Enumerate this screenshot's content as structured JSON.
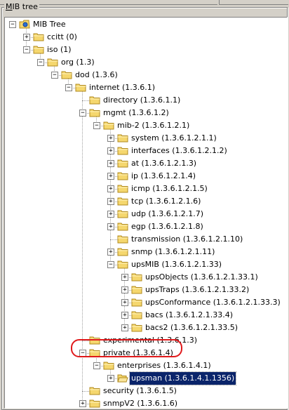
{
  "panel": {
    "title": "MIB tree"
  },
  "tree": [
    {
      "label": "MIB Tree",
      "level": 0,
      "exp": "-",
      "icon": "root"
    },
    {
      "label": "ccitt (0)",
      "level": 1,
      "exp": "+",
      "icon": "folder"
    },
    {
      "label": "iso (1)",
      "level": 1,
      "exp": "-",
      "icon": "folder"
    },
    {
      "label": "org (1.3)",
      "level": 2,
      "exp": "-",
      "icon": "folder"
    },
    {
      "label": "dod (1.3.6)",
      "level": 3,
      "exp": "-",
      "icon": "folder"
    },
    {
      "label": "internet (1.3.6.1)",
      "level": 4,
      "exp": "-",
      "icon": "folder"
    },
    {
      "label": "directory (1.3.6.1.1)",
      "level": 5,
      "exp": "",
      "icon": "folder"
    },
    {
      "label": "mgmt (1.3.6.1.2)",
      "level": 5,
      "exp": "-",
      "icon": "folder"
    },
    {
      "label": "mib-2 (1.3.6.1.2.1)",
      "level": 6,
      "exp": "-",
      "icon": "folder"
    },
    {
      "label": "system (1.3.6.1.2.1.1)",
      "level": 7,
      "exp": "+",
      "icon": "folder"
    },
    {
      "label": "interfaces (1.3.6.1.2.1.2)",
      "level": 7,
      "exp": "+",
      "icon": "folder"
    },
    {
      "label": "at (1.3.6.1.2.1.3)",
      "level": 7,
      "exp": "+",
      "icon": "folder"
    },
    {
      "label": "ip (1.3.6.1.2.1.4)",
      "level": 7,
      "exp": "+",
      "icon": "folder"
    },
    {
      "label": "icmp (1.3.6.1.2.1.5)",
      "level": 7,
      "exp": "+",
      "icon": "folder"
    },
    {
      "label": "tcp (1.3.6.1.2.1.6)",
      "level": 7,
      "exp": "+",
      "icon": "folder"
    },
    {
      "label": "udp (1.3.6.1.2.1.7)",
      "level": 7,
      "exp": "+",
      "icon": "folder"
    },
    {
      "label": "egp (1.3.6.1.2.1.8)",
      "level": 7,
      "exp": "+",
      "icon": "folder"
    },
    {
      "label": "transmission (1.3.6.1.2.1.10)",
      "level": 7,
      "exp": "",
      "icon": "folder"
    },
    {
      "label": "snmp (1.3.6.1.2.1.11)",
      "level": 7,
      "exp": "+",
      "icon": "folder"
    },
    {
      "label": "upsMIB (1.3.6.1.2.1.33)",
      "level": 7,
      "exp": "-",
      "icon": "folder"
    },
    {
      "label": "upsObjects (1.3.6.1.2.1.33.1)",
      "level": 8,
      "exp": "+",
      "icon": "folder"
    },
    {
      "label": "upsTraps (1.3.6.1.2.1.33.2)",
      "level": 8,
      "exp": "+",
      "icon": "folder"
    },
    {
      "label": "upsConformance (1.3.6.1.2.1.33.3)",
      "level": 8,
      "exp": "+",
      "icon": "folder"
    },
    {
      "label": "bacs (1.3.6.1.2.1.33.4)",
      "level": 8,
      "exp": "+",
      "icon": "folder"
    },
    {
      "label": "bacs2 (1.3.6.1.2.1.33.5)",
      "level": 8,
      "exp": "+",
      "icon": "folder"
    },
    {
      "label": "experimental (1.3.6.1.3)",
      "level": 5,
      "exp": "",
      "icon": "folder"
    },
    {
      "label": "private (1.3.6.1.4)",
      "level": 5,
      "exp": "-",
      "icon": "folder",
      "ring": true
    },
    {
      "label": "enterprises (1.3.6.1.4.1)",
      "level": 6,
      "exp": "-",
      "icon": "folder"
    },
    {
      "label": "upsman (1.3.6.1.4.1.1356)",
      "level": 7,
      "exp": "+",
      "icon": "folder-open",
      "selected": true
    },
    {
      "label": "security (1.3.6.1.5)",
      "level": 5,
      "exp": "",
      "icon": "folder"
    },
    {
      "label": "snmpV2 (1.3.6.1.6)",
      "level": 5,
      "exp": "+",
      "icon": "folder"
    }
  ],
  "colors": {
    "selection_bg": "#0a246a",
    "folder_fill": "#f5d76e",
    "folder_edge": "#b08a1e",
    "highlight_ring": "#e0191b"
  }
}
